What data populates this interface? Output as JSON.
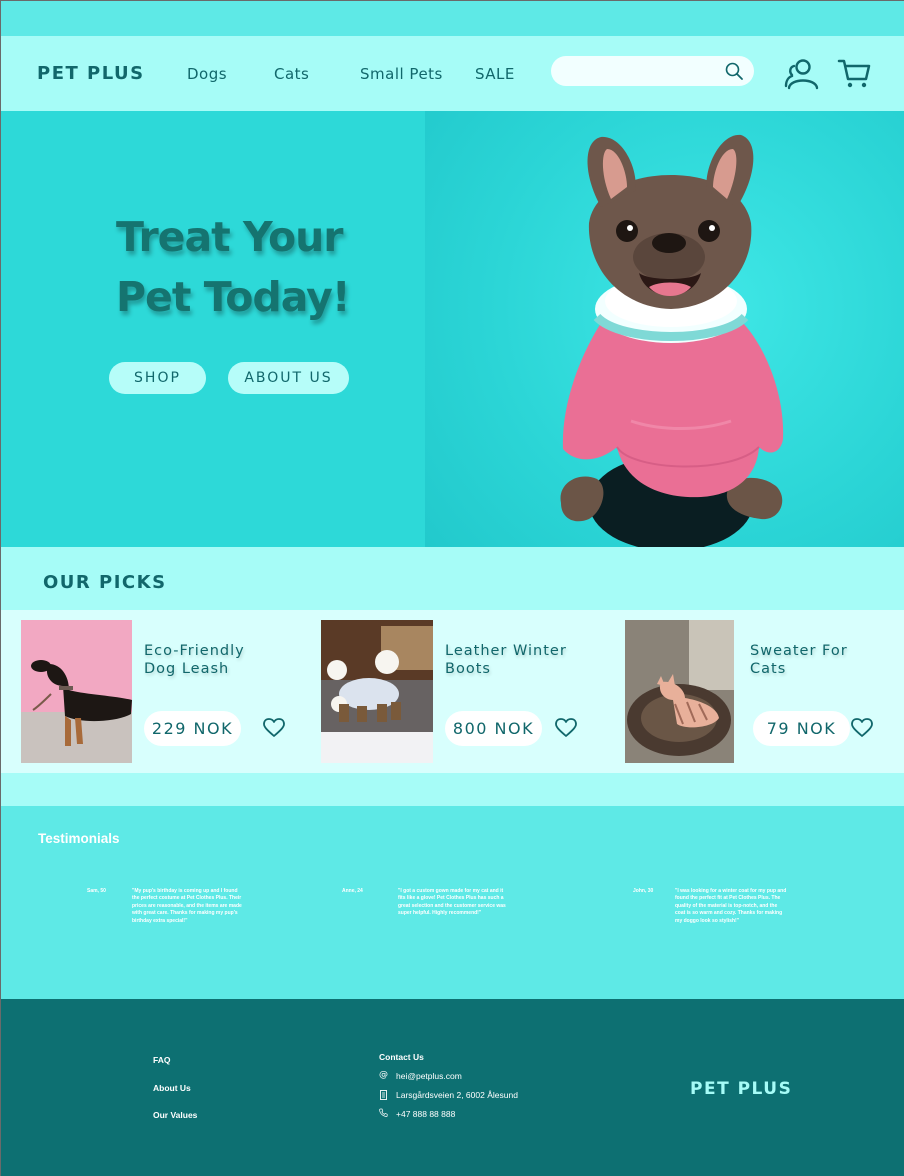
{
  "brand": "PET PLUS",
  "nav": {
    "links": [
      "Dogs",
      "Cats",
      "Small Pets",
      "SALE"
    ],
    "search": {
      "value": "",
      "placeholder": ""
    }
  },
  "hero": {
    "title_line1": "Treat Your",
    "title_line2": "Pet Today!",
    "shop_label": "SHOP",
    "about_label": "ABOUT US"
  },
  "picks": {
    "title": "OUR PICKS",
    "products": [
      {
        "name_line1": "Eco-Friendly",
        "name_line2": "Dog Leash",
        "price": "229 NOK"
      },
      {
        "name_line1": "Leather Winter",
        "name_line2": "Boots",
        "price": "800 NOK"
      },
      {
        "name_line1": "Sweater For",
        "name_line2": "Cats",
        "price": "79 NOK"
      }
    ]
  },
  "testimonials": {
    "title": "Testimonials",
    "items": [
      {
        "name": "Sam, 50",
        "text": "\"My pup's birthday is coming up and I found the perfect costume at Pet Clothes Plus. Their prices are reasonable, and the items are made with great care. Thanks for making my pup's birthday extra special!\""
      },
      {
        "name": "Anne, 24",
        "text": "\"I got a custom gown made for my cat and it fits like a glove! Pet Clothes Plus has such a great selection and the customer service was super helpful. Highly recommend!\""
      },
      {
        "name": "John, 30",
        "text": "\"I was looking for a winter coat for my pup and found the perfect fit at Pet Clothes Plus. The quality of the material is top-notch, and the coat is so warm and cozy. Thanks for making my doggo look so stylish!\""
      }
    ]
  },
  "footer": {
    "links": [
      "FAQ",
      "About Us",
      "Our Values"
    ],
    "contact_title": "Contact Us",
    "email": "hei@petplus.com",
    "address": "Larsgårdsveien 2, 6002 Ålesund",
    "phone": "+47 888 88 888",
    "logo": "PET PLUS"
  },
  "colors": {
    "primary_dark": "#11676b",
    "nav_bg": "#a6fcf7",
    "hero_bg": "#2dd9d8",
    "page_bg": "#5ee9e6",
    "footer_bg": "#0d7072",
    "sweater_pink": "#ea6f95"
  },
  "icons": [
    "search-icon",
    "user-icon",
    "cart-icon",
    "heart-icon",
    "at-icon",
    "building-icon",
    "phone-icon"
  ]
}
